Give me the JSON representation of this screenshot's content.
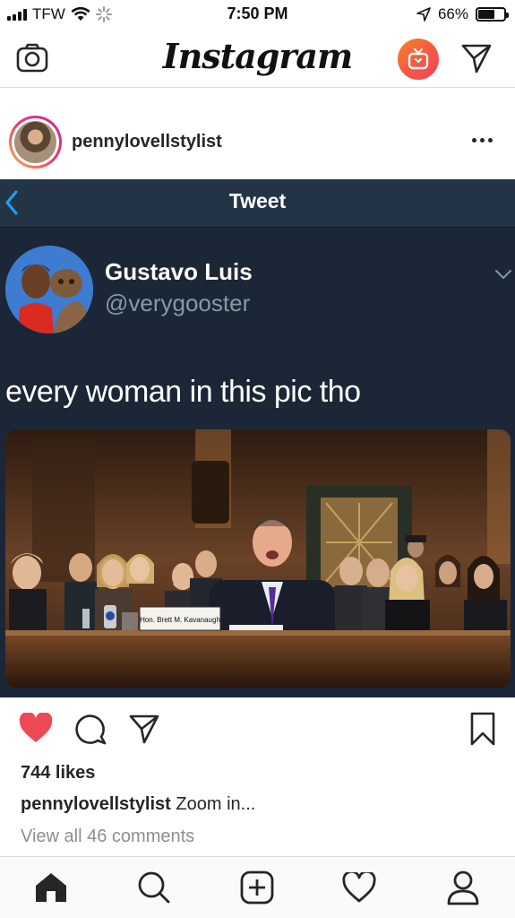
{
  "status_bar": {
    "carrier": "TFW",
    "time": "7:50 PM",
    "battery_percent": "66%",
    "battery_level": 0.66
  },
  "nav": {
    "logo": "Instagram",
    "icons": [
      "camera-icon",
      "igtv-icon",
      "direct-message-icon"
    ]
  },
  "post": {
    "username": "pennylovellstylist",
    "likes": "744 likes",
    "caption_user": "pennylovellstylist",
    "caption_text": "Zoom in...",
    "view_comments": "View all 46 comments"
  },
  "tweet": {
    "header_title": "Tweet",
    "author_name": "Gustavo Luis",
    "author_handle": "@verygooster",
    "text": "every woman in this pic tho",
    "nameplate": "Hon. Brett M. Kavanaugh"
  },
  "colors": {
    "tweet_bg": "#1b2736",
    "tweet_header": "#243447",
    "like_red": "#ed4956",
    "link_blue": "#1da1f2"
  },
  "tabbar": {
    "icons": [
      "home-icon",
      "search-icon",
      "add-post-icon",
      "activity-heart-icon",
      "profile-icon"
    ]
  }
}
